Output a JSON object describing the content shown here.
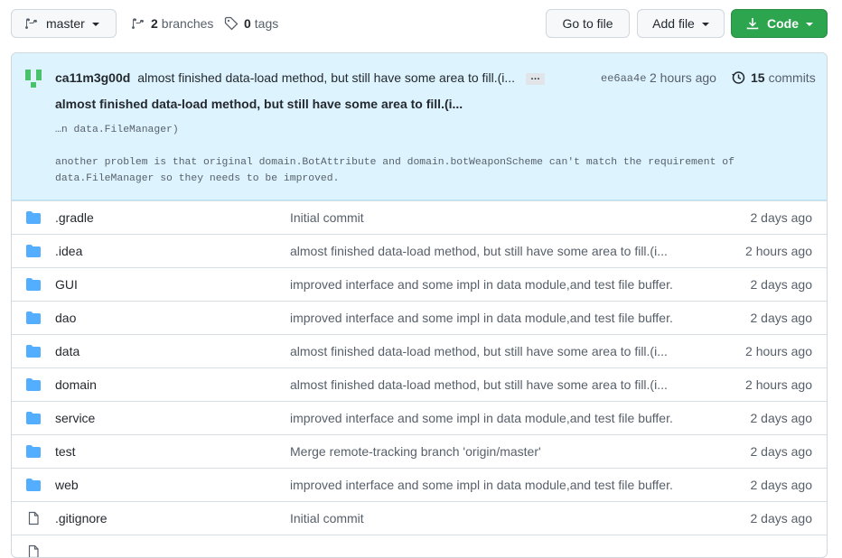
{
  "toolbar": {
    "branch": "master",
    "branches_count": "2",
    "branches_label": "branches",
    "tags_count": "0",
    "tags_label": "tags",
    "goto_file": "Go to file",
    "add_file": "Add file",
    "code": "Code"
  },
  "commit": {
    "author": "ca11m3g00d",
    "message_short": "almost finished data-load method, but still have some area to fill.(i...",
    "ellipsis": "…",
    "sha": "ee6aa4e",
    "time": "2 hours ago",
    "commits_count": "15",
    "commits_label": "commits",
    "title": "almost finished data-load method, but still have some area to fill.(i...",
    "body_line1": "…n data.FileManager)",
    "body_line2": "another problem is that original domain.BotAttribute and domain.botWeaponScheme can't match the requirement of data.FileManager so they needs to be improved."
  },
  "files": [
    {
      "name": ".gradle",
      "type": "folder",
      "message": "Initial commit",
      "age": "2 days ago"
    },
    {
      "name": ".idea",
      "type": "folder",
      "message": "almost finished data-load method, but still have some area to fill.(i...",
      "age": "2 hours ago"
    },
    {
      "name": "GUI",
      "type": "folder",
      "message": "improved interface and some impl in data module,and test file buffer.",
      "age": "2 days ago"
    },
    {
      "name": "dao",
      "type": "folder",
      "message": "improved interface and some impl in data module,and test file buffer.",
      "age": "2 days ago"
    },
    {
      "name": "data",
      "type": "folder",
      "message": "almost finished data-load method, but still have some area to fill.(i...",
      "age": "2 hours ago"
    },
    {
      "name": "domain",
      "type": "folder",
      "message": "almost finished data-load method, but still have some area to fill.(i...",
      "age": "2 hours ago"
    },
    {
      "name": "service",
      "type": "folder",
      "message": "improved interface and some impl in data module,and test file buffer.",
      "age": "2 days ago"
    },
    {
      "name": "test",
      "type": "folder",
      "message": "Merge remote-tracking branch 'origin/master'",
      "age": "2 days ago"
    },
    {
      "name": "web",
      "type": "folder",
      "message": "improved interface and some impl in data module,and test file buffer.",
      "age": "2 days ago"
    },
    {
      "name": ".gitignore",
      "type": "file",
      "message": "Initial commit",
      "age": "2 days ago"
    }
  ],
  "colors": {
    "accent_green": "#2da44e",
    "folder_blue": "#54aeff",
    "commit_bg": "#ddf4ff"
  }
}
